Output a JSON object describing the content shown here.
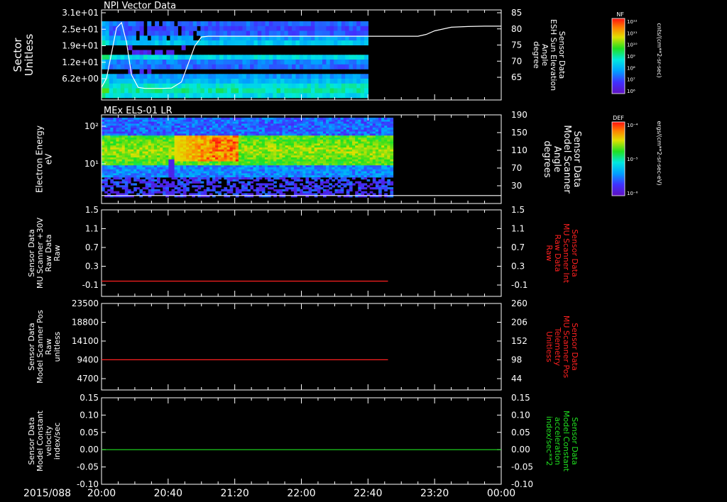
{
  "page_colors": {
    "background": "#000000",
    "foreground": "#ffffff",
    "red_trace": "#ff2020",
    "green_trace": "#20e020"
  },
  "time_axis": {
    "date_label": "2015/088",
    "ticks": [
      "20:00",
      "20:40",
      "21:20",
      "22:00",
      "22:40",
      "23:20",
      "00:00"
    ],
    "range_minutes": [
      0,
      240
    ],
    "data_end_minutes": 172
  },
  "chart_data": [
    {
      "type": "heatmap",
      "title": "NPI Vector Data",
      "ylabel_left": [
        "Sector",
        "Unitless"
      ],
      "y_ticks_left": [
        "3.1e+01",
        "2.5e+01",
        "1.9e+01",
        "1.2e+01",
        "6.2e+00"
      ],
      "ylabel_right": [
        "Sensor Data",
        "ESH Sun Elevation",
        "Angle",
        "degree"
      ],
      "y_ticks_right": [
        85,
        80,
        75,
        70,
        65
      ],
      "ylim_right": [
        60,
        85
      ],
      "colorbar": {
        "label": "NF",
        "units": "cnts/(cm**2-sr-sec)",
        "ticks": [
          "10¹²",
          "10¹¹",
          "10¹⁰",
          "10⁹",
          "10⁸",
          "10⁷",
          "10⁶"
        ]
      },
      "overlay_line": {
        "x": [
          0,
          3,
          6,
          9,
          12,
          15,
          18,
          22,
          26,
          30,
          36,
          42,
          48,
          52,
          56,
          60,
          64,
          70,
          80,
          100,
          120,
          140,
          160,
          172,
          190,
          195,
          200,
          210,
          220,
          230,
          240
        ],
        "y": [
          63.5,
          66,
          73,
          80,
          81.5,
          76,
          67,
          63.5,
          63.2,
          63.2,
          63.2,
          63.3,
          65,
          70,
          75,
          77.5,
          77.7,
          77.7,
          77.7,
          77.7,
          77.7,
          77.7,
          77.7,
          77.7,
          77.7,
          78.2,
          79.2,
          80.2,
          80.4,
          80.5,
          80.5
        ]
      }
    },
    {
      "type": "heatmap",
      "title": "MEx ELS-01 LR",
      "ylabel_left": [
        "Electron Energy",
        "eV"
      ],
      "y_ticks_left": [
        "10²",
        "10¹"
      ],
      "ylabel_right": [
        "Sensor Data",
        "Model Scanner",
        "Angle",
        "degrees"
      ],
      "y_ticks_right": [
        190,
        150,
        110,
        70,
        30
      ],
      "ylim_right": [
        0,
        190
      ],
      "colorbar": {
        "label": "DEF",
        "units": "ergs/(cm**2-sr-sec-eV)",
        "ticks": [
          "10⁻⁴",
          "10⁻⁵",
          "10⁻⁶"
        ]
      },
      "overlay_line": {
        "x": [
          0,
          240
        ],
        "y": [
          17,
          17
        ]
      }
    },
    {
      "type": "line",
      "ylabel_left": [
        "Sensor Data",
        "MU Scanner +30V",
        "Raw Data",
        "Raw"
      ],
      "y_ticks_left": [
        "1.5",
        "1.1",
        "0.7",
        "0.3",
        "-0.1"
      ],
      "ylim": [
        -0.32,
        1.5
      ],
      "ylabel_right": [
        "Sensor Data",
        "MU Scanner Int",
        "Raw Data",
        "Raw"
      ],
      "y_ticks_right": [
        "1.5",
        "1.1",
        "0.7",
        "0.3",
        "-0.1"
      ],
      "right_label_color": "#ff2020",
      "series": [
        {
          "color": "#ff2020",
          "x": [
            0,
            172
          ],
          "y": [
            0.0,
            0.0
          ]
        }
      ]
    },
    {
      "type": "line",
      "ylabel_left": [
        "Sensor Data",
        "Model Scanner Pos",
        "Raw",
        "unitless"
      ],
      "y_ticks_left": [
        "23500",
        "18800",
        "14100",
        "9400",
        "4700"
      ],
      "ylim": [
        0,
        23500
      ],
      "ylabel_right": [
        "Sensor Data",
        "MU Scanner Pos",
        "Telemetry",
        "Unitless"
      ],
      "y_ticks_right": [
        "260",
        "206",
        "152",
        "98",
        "44"
      ],
      "right_label_color": "#ff2020",
      "series": [
        {
          "color": "#ff2020",
          "x": [
            0,
            172
          ],
          "y": [
            8200,
            8200
          ]
        }
      ]
    },
    {
      "type": "line",
      "ylabel_left": [
        "Sensor Data",
        "Model Constant",
        "velocity",
        "index/sec"
      ],
      "y_ticks_left": [
        "0.15",
        "0.10",
        "0.05",
        "0.00",
        "-0.05",
        "-0.10"
      ],
      "ylim": [
        -0.1,
        0.15
      ],
      "ylabel_right": [
        "Sensor Data",
        "Model Constant",
        "acceleration",
        "index/sec**2"
      ],
      "y_ticks_right": [
        "0.15",
        "0.10",
        "0.05",
        "0.00",
        "-0.05",
        "-0.10"
      ],
      "right_label_color": "#20e020",
      "series": [
        {
          "color": "#20e020",
          "x": [
            0,
            240
          ],
          "y": [
            0.0,
            0.0
          ]
        }
      ]
    }
  ]
}
